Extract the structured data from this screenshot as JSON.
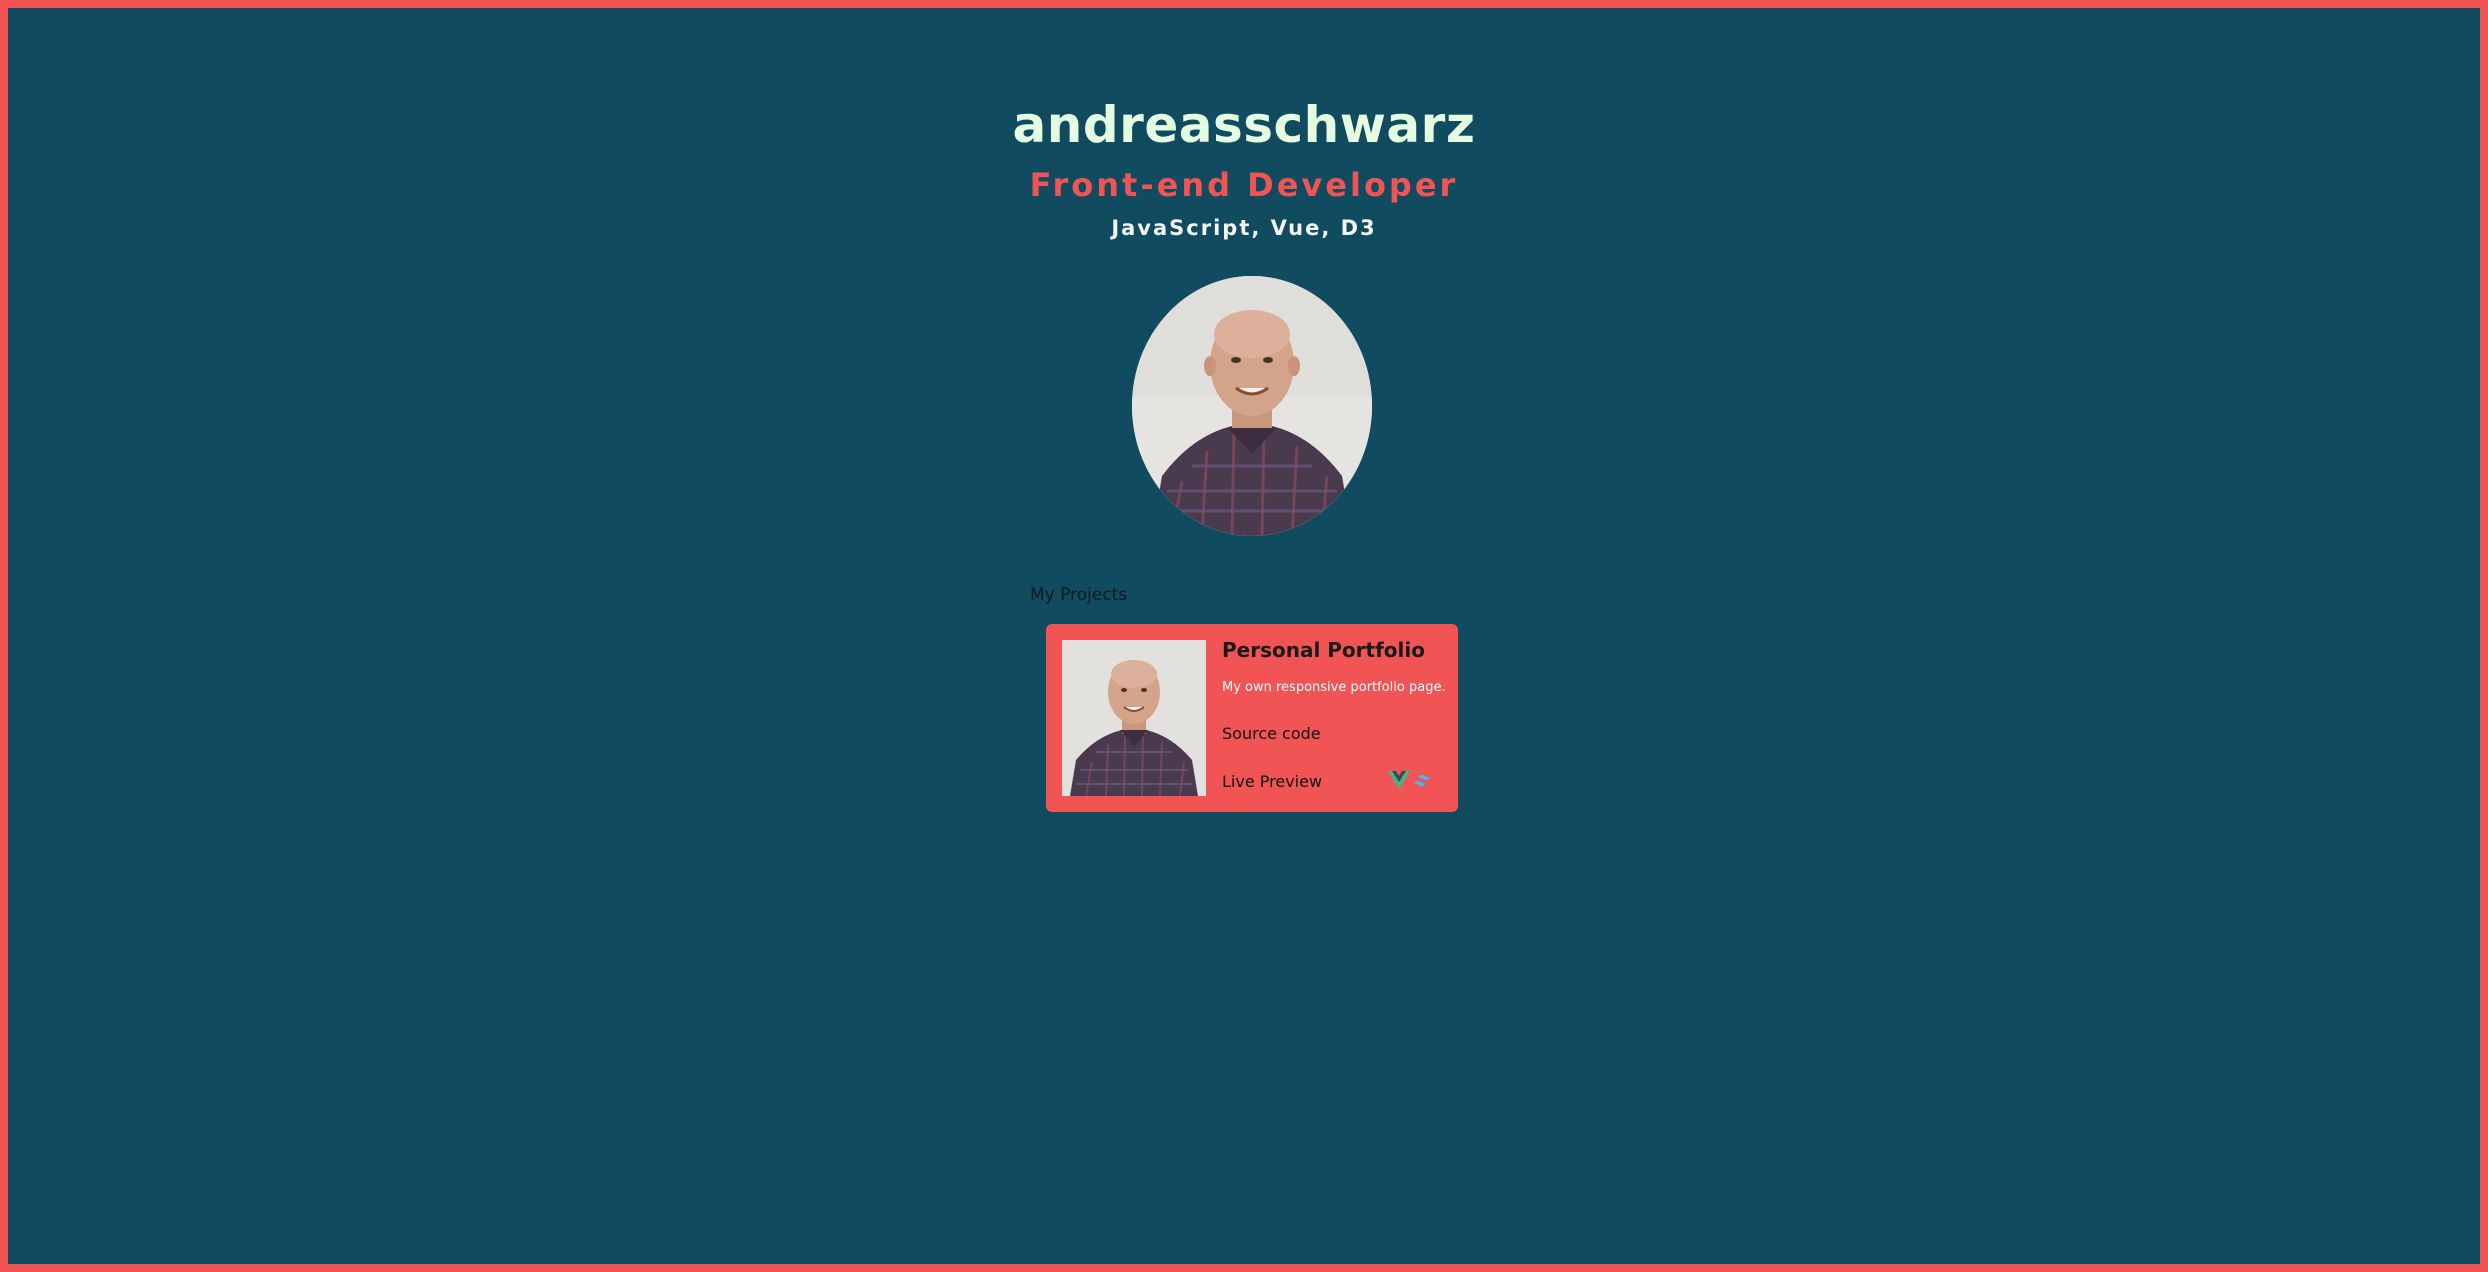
{
  "header": {
    "name": "andreasschwarz",
    "role": "Front-end Developer",
    "skills": "JavaScript, Vue, D3"
  },
  "avatar": {
    "icon": "profile-photo"
  },
  "projects": {
    "section_title": "My Projects",
    "items": [
      {
        "title": "Personal Portfolio",
        "description": "My own responsive portfolio page.",
        "source_label": "Source code",
        "preview_label": "Live Preview",
        "thumbnail_icon": "profile-photo",
        "tech_icons": [
          "vue-icon",
          "tailwind-icon"
        ]
      }
    ]
  },
  "colors": {
    "background": "#114b5f",
    "accent": "#f05454",
    "name_text": "#e4fde1",
    "skills_text": "#f5f5f5"
  }
}
